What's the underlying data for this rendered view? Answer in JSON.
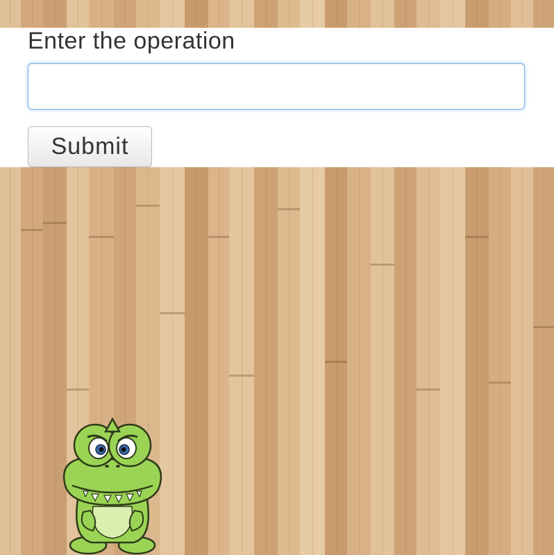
{
  "form": {
    "prompt_label": "Enter the operation",
    "input_value": "",
    "input_placeholder": "",
    "submit_label": "Submit"
  },
  "scene": {
    "background": "wood-floor",
    "character": "crocodile-mascot"
  },
  "colors": {
    "panel": "#ffffff",
    "input_focus_border": "#7fb0e8",
    "text": "#333333",
    "croc_green": "#9bd454",
    "croc_belly": "#d8efb0"
  }
}
